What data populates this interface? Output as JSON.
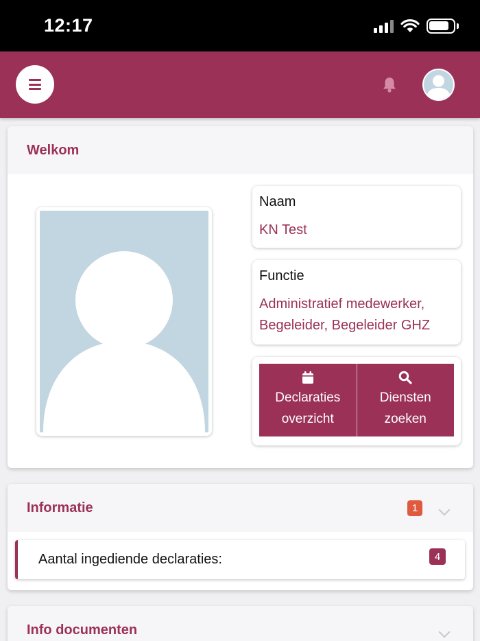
{
  "status_bar": {
    "time": "12:17"
  },
  "welcome_card": {
    "title": "Welkom",
    "name": {
      "label": "Naam",
      "value": "KN Test"
    },
    "function": {
      "label": "Functie",
      "value": "Administratief medewerker, Begeleider, Begeleider GHZ"
    },
    "actions": [
      {
        "line1": "Declaraties",
        "line2": "overzicht",
        "icon": "calendar-icon"
      },
      {
        "line1": "Diensten",
        "line2": "zoeken",
        "icon": "search-icon"
      }
    ]
  },
  "info_card": {
    "title": "Informatie",
    "badge": "1",
    "items": [
      {
        "label": "Aantal ingediende declaraties:",
        "count": "4"
      }
    ]
  },
  "docs_card": {
    "title": "Info documenten"
  },
  "colors": {
    "brand": "#9b3157",
    "badge_red": "#e05a3f",
    "placeholder": "#c2d6e2"
  }
}
